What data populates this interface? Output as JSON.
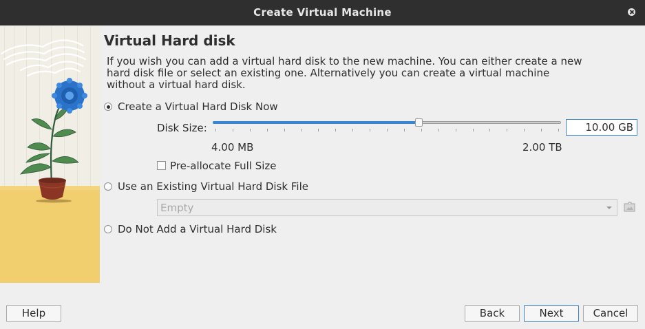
{
  "window": {
    "title": "Create Virtual Machine"
  },
  "page": {
    "title": "Virtual Hard disk",
    "description": "If you wish you can add a virtual hard disk to the new machine. You can either create a new hard disk file or select an existing one. Alternatively you can create a virtual machine without a virtual hard disk."
  },
  "options": {
    "create_now": {
      "label": "Create a Virtual Hard Disk Now",
      "selected": true
    },
    "use_existing": {
      "label": "Use an Existing Virtual Hard Disk File",
      "selected": false
    },
    "no_disk": {
      "label": "Do Not Add a Virtual Hard Disk",
      "selected": false
    }
  },
  "disk_size": {
    "label": "Disk Size:",
    "value": "10.00 GB",
    "min_label": "4.00 MB",
    "max_label": "2.00 TB",
    "slider_position_fraction": 0.59,
    "tick_count": 21
  },
  "preallocate": {
    "label": "Pre-allocate Full Size",
    "checked": false
  },
  "existing_file": {
    "selected": "Empty"
  },
  "buttons": {
    "help": "Help",
    "back": "Back",
    "next": "Next",
    "cancel": "Cancel"
  },
  "colors": {
    "accent": "#3a86d4",
    "titlebar": "#2f2f2f",
    "background": "#efefef"
  }
}
